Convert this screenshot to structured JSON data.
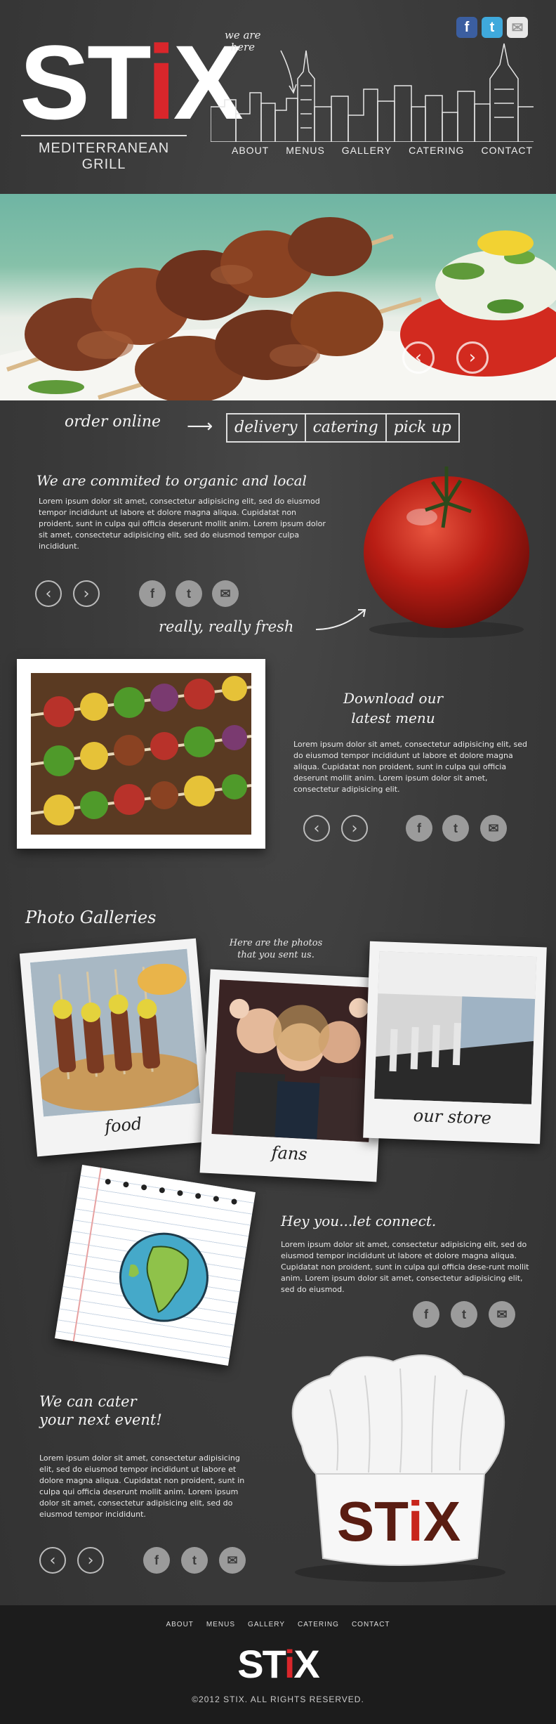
{
  "brand": {
    "logo_text_left": "ST",
    "logo_text_mid": "i",
    "logo_text_right": "X",
    "subtitle": "MEDITERRANEAN GRILL",
    "accent_color": "#d9262b"
  },
  "social_top": [
    {
      "icon": "facebook-icon",
      "glyph": "f",
      "color": "#3b5ea0"
    },
    {
      "icon": "twitter-icon",
      "glyph": "t",
      "color": "#3fa9dc"
    },
    {
      "icon": "mail-icon",
      "glyph": "✉",
      "color": "#e8e8e8"
    }
  ],
  "header": {
    "we_are_line1": "we are",
    "we_are_line2": "here"
  },
  "nav": [
    "ABOUT",
    "MENUS",
    "GALLERY",
    "CATERING",
    "CONTACT"
  ],
  "hero": {
    "prev_glyph": "‹",
    "next_glyph": "›"
  },
  "order": {
    "label": "order online",
    "arrow": "⟶",
    "options": [
      "delivery",
      "catering",
      "pick up"
    ]
  },
  "organic": {
    "heading": "We are commited to organic and local",
    "body": "Lorem ipsum dolor sit amet, consectetur adipisicing elit, sed do eiusmod tempor incididunt ut labore et dolore magna aliqua. Cupidatat non proident, sunt in culpa qui officia deserunt mollit anim. Lorem ipsum dolor sit amet, consectetur adipisicing elit, sed do eiusmod tempor culpa incididunt.",
    "tagline": "really, really fresh"
  },
  "menu": {
    "heading_line1": "Download our",
    "heading_line2": "latest menu",
    "body": "Lorem ipsum dolor sit amet, consectetur adipisicing elit, sed do eiusmod tempor incididunt ut labore et dolore magna aliqua. Cupidatat non proident, sunt in culpa qui officia deserunt mollit anim. Lorem ipsum dolor sit amet, consectetur adipisicing elit."
  },
  "galleries": {
    "heading": "Photo Galleries",
    "note_line1": "Here are the photos",
    "note_line2": "that you sent us.",
    "items": [
      {
        "caption": "food"
      },
      {
        "caption": "fans"
      },
      {
        "caption": "our store"
      }
    ]
  },
  "connect": {
    "heading": "Hey you...let connect.",
    "body": "Lorem ipsum dolor sit amet, consectetur adipisicing elit, sed do eiusmod tempor incididunt ut labore et dolore magna aliqua. Cupidatat non proident, sunt in culpa qui officia dese-runt mollit anim. Lorem ipsum dolor sit amet, consectetur adipisicing elit, sed do eiusmod."
  },
  "cater": {
    "heading_line1": "We can cater",
    "heading_line2": "your next event!",
    "body": "Lorem ipsum dolor sit amet, consectetur adipisicing elit, sed do eiusmod tempor incididunt ut labore et dolore magna aliqua. Cupidatat non proident, sunt in culpa qui officia deserunt mollit anim. Lorem ipsum dolor sit amet, consectetur adipisicing elit, sed do eiusmod tempor incididunt.",
    "hat_text_left": "ST",
    "hat_text_mid": "i",
    "hat_text_right": "X"
  },
  "controls": {
    "prev": "‹",
    "next": "›",
    "fb": "f",
    "tw": "t",
    "mail": "✉"
  },
  "footer": {
    "nav": [
      "ABOUT",
      "MENUS",
      "GALLERY",
      "CATERING",
      "CONTACT"
    ],
    "logo_left": "ST",
    "logo_mid": "i",
    "logo_right": "X",
    "copyright": "©2012   STIX. ALL RIGHTS RESERVED."
  }
}
